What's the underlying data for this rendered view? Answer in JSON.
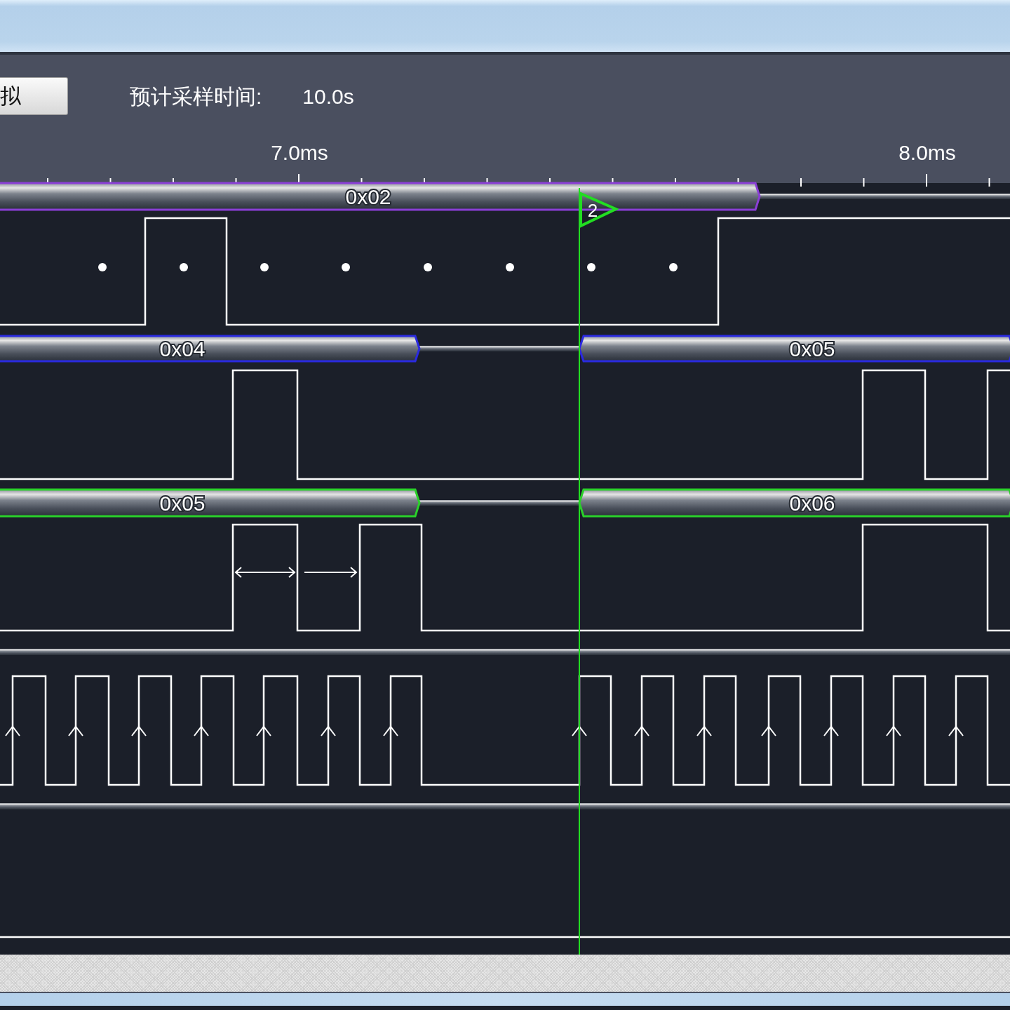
{
  "toolbar": {
    "button": {
      "label": "拟"
    },
    "estimate_label": "预计采样时间:",
    "estimate_value": "10.0s"
  },
  "ruler": {
    "labels": [
      "7.0ms",
      "8.0ms"
    ]
  },
  "marker": {
    "label": "2"
  },
  "buses": [
    {
      "color": "#8a3fd6",
      "segments": [
        "0x02"
      ]
    },
    {
      "color": "#2a2ae0",
      "segments": [
        "0x04",
        "0x05"
      ]
    },
    {
      "color": "#2ad02a",
      "segments": [
        "0x05",
        "0x06"
      ]
    }
  ]
}
